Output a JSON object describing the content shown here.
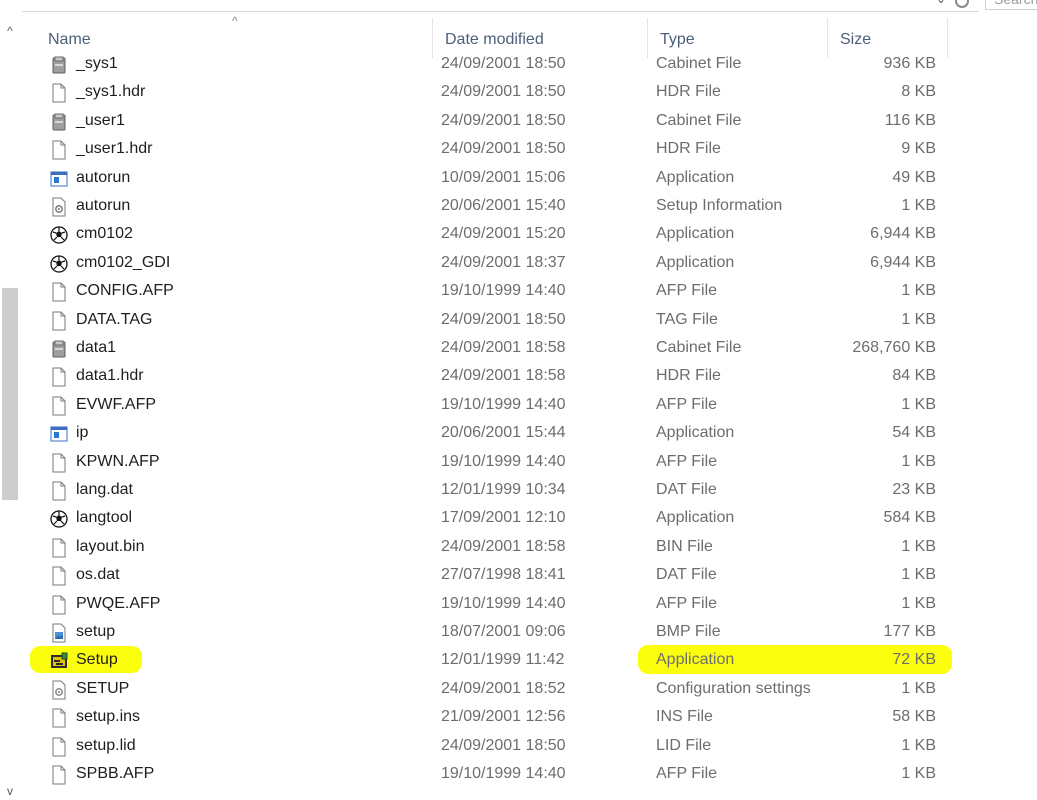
{
  "top_bar": {
    "search_placeholder": "Search",
    "dropdown_glyph": "⌄"
  },
  "scrollbar": {
    "up_glyph": "^",
    "down_glyph": "v"
  },
  "columns": {
    "name": "Name",
    "date": "Date modified",
    "type": "Type",
    "size": "Size"
  },
  "sort_glyph": "^",
  "highlight_color": "#fbff00",
  "files": [
    {
      "name": "_sys1",
      "date": "24/09/2001 18:50",
      "type": "Cabinet File",
      "size": "936 KB",
      "icon": "cabinet-icon"
    },
    {
      "name": "_sys1.hdr",
      "date": "24/09/2001 18:50",
      "type": "HDR File",
      "size": "8 KB",
      "icon": "file-icon"
    },
    {
      "name": "_user1",
      "date": "24/09/2001 18:50",
      "type": "Cabinet File",
      "size": "116 KB",
      "icon": "cabinet-icon"
    },
    {
      "name": "_user1.hdr",
      "date": "24/09/2001 18:50",
      "type": "HDR File",
      "size": "9 KB",
      "icon": "file-icon"
    },
    {
      "name": "autorun",
      "date": "10/09/2001 15:06",
      "type": "Application",
      "size": "49 KB",
      "icon": "application-window-icon"
    },
    {
      "name": "autorun",
      "date": "20/06/2001 15:40",
      "type": "Setup Information",
      "size": "1 KB",
      "icon": "setup-info-icon"
    },
    {
      "name": "cm0102",
      "date": "24/09/2001 15:20",
      "type": "Application",
      "size": "6,944 KB",
      "icon": "soccer-ball-icon"
    },
    {
      "name": "cm0102_GDI",
      "date": "24/09/2001 18:37",
      "type": "Application",
      "size": "6,944 KB",
      "icon": "soccer-ball-icon"
    },
    {
      "name": "CONFIG.AFP",
      "date": "19/10/1999 14:40",
      "type": "AFP File",
      "size": "1 KB",
      "icon": "file-icon"
    },
    {
      "name": "DATA.TAG",
      "date": "24/09/2001 18:50",
      "type": "TAG File",
      "size": "1 KB",
      "icon": "file-icon"
    },
    {
      "name": "data1",
      "date": "24/09/2001 18:58",
      "type": "Cabinet File",
      "size": "268,760 KB",
      "icon": "cabinet-icon"
    },
    {
      "name": "data1.hdr",
      "date": "24/09/2001 18:58",
      "type": "HDR File",
      "size": "84 KB",
      "icon": "file-icon"
    },
    {
      "name": "EVWF.AFP",
      "date": "19/10/1999 14:40",
      "type": "AFP File",
      "size": "1 KB",
      "icon": "file-icon"
    },
    {
      "name": "ip",
      "date": "20/06/2001 15:44",
      "type": "Application",
      "size": "54 KB",
      "icon": "application-window-icon"
    },
    {
      "name": "KPWN.AFP",
      "date": "19/10/1999 14:40",
      "type": "AFP File",
      "size": "1 KB",
      "icon": "file-icon"
    },
    {
      "name": "lang.dat",
      "date": "12/01/1999 10:34",
      "type": "DAT File",
      "size": "23 KB",
      "icon": "file-icon"
    },
    {
      "name": "langtool",
      "date": "17/09/2001 12:10",
      "type": "Application",
      "size": "584 KB",
      "icon": "soccer-ball-icon"
    },
    {
      "name": "layout.bin",
      "date": "24/09/2001 18:58",
      "type": "BIN File",
      "size": "1 KB",
      "icon": "file-icon"
    },
    {
      "name": "os.dat",
      "date": "27/07/1998 18:41",
      "type": "DAT File",
      "size": "1 KB",
      "icon": "file-icon"
    },
    {
      "name": "PWQE.AFP",
      "date": "19/10/1999 14:40",
      "type": "AFP File",
      "size": "1 KB",
      "icon": "file-icon"
    },
    {
      "name": "setup",
      "date": "18/07/2001 09:06",
      "type": "BMP File",
      "size": "177 KB",
      "icon": "bitmap-icon"
    },
    {
      "name": "Setup",
      "date": "12/01/1999 11:42",
      "type": "Application",
      "size": "72 KB",
      "icon": "installer-icon",
      "highlighted": true
    },
    {
      "name": "SETUP",
      "date": "24/09/2001 18:52",
      "type": "Configuration settings",
      "size": "1 KB",
      "icon": "settings-file-icon"
    },
    {
      "name": "setup.ins",
      "date": "21/09/2001 12:56",
      "type": "INS File",
      "size": "58 KB",
      "icon": "file-icon"
    },
    {
      "name": "setup.lid",
      "date": "24/09/2001 18:50",
      "type": "LID File",
      "size": "1 KB",
      "icon": "file-icon"
    },
    {
      "name": "SPBB.AFP",
      "date": "19/10/1999 14:40",
      "type": "AFP File",
      "size": "1 KB",
      "icon": "file-icon"
    }
  ]
}
